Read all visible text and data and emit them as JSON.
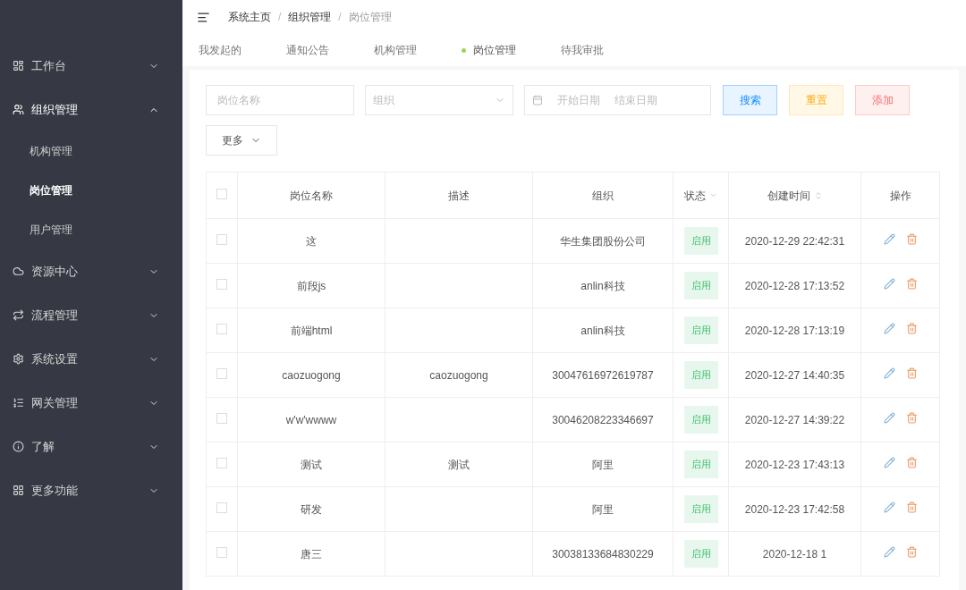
{
  "sidebar": {
    "items": [
      {
        "label": "工作台",
        "expanded": false
      },
      {
        "label": "组织管理",
        "expanded": true,
        "children": [
          {
            "label": "机构管理",
            "selected": false
          },
          {
            "label": "岗位管理",
            "selected": true
          },
          {
            "label": "用户管理",
            "selected": false
          }
        ]
      },
      {
        "label": "资源中心",
        "expanded": false
      },
      {
        "label": "流程管理",
        "expanded": false
      },
      {
        "label": "系统设置",
        "expanded": false
      },
      {
        "label": "网关管理",
        "expanded": false
      },
      {
        "label": "了解",
        "expanded": false
      },
      {
        "label": "更多功能",
        "expanded": false
      }
    ]
  },
  "breadcrumb": {
    "separator": "/",
    "items": [
      "系统主页",
      "组织管理",
      "岗位管理"
    ]
  },
  "tabs": [
    {
      "label": "我发起的",
      "selected": false
    },
    {
      "label": "通知公告",
      "selected": false
    },
    {
      "label": "机构管理",
      "selected": false
    },
    {
      "label": "岗位管理",
      "selected": true
    },
    {
      "label": "待我审批",
      "selected": false
    }
  ],
  "filters": {
    "name_placeholder": "岗位名称",
    "org_placeholder": "组织",
    "start_placeholder": "开始日期",
    "end_placeholder": "结束日期",
    "more": "更多"
  },
  "buttons": [
    {
      "label": "搜索",
      "kind": "search"
    },
    {
      "label": "重置",
      "kind": "reset"
    },
    {
      "label": "添加",
      "kind": "add"
    }
  ],
  "table": {
    "all_checked": false,
    "columns": [
      "岗位名称",
      "描述",
      "组织",
      "状态",
      "创建时间",
      "操作"
    ],
    "rows": [
      {
        "checked": false,
        "name": "这",
        "desc": "",
        "org": "华生集团股份公司",
        "status": "启用",
        "created": "2020-12-29 22:42:31"
      },
      {
        "checked": false,
        "name": "前段js",
        "desc": "",
        "org": "anlin科技",
        "status": "启用",
        "created": "2020-12-28 17:13:52"
      },
      {
        "checked": false,
        "name": "前端html",
        "desc": "",
        "org": "anlin科技",
        "status": "启用",
        "created": "2020-12-28 17:13:19"
      },
      {
        "checked": false,
        "name": "caozuogong",
        "desc": "caozuogong",
        "org": "30047616972619787",
        "status": "启用",
        "created": "2020-12-27 14:40:35"
      },
      {
        "checked": false,
        "name": "w'w'wwww",
        "desc": "",
        "org": "30046208223346697",
        "status": "启用",
        "created": "2020-12-27 14:39:22"
      },
      {
        "checked": false,
        "name": "测试",
        "desc": "测试",
        "org": "阿里",
        "status": "启用",
        "created": "2020-12-23 17:43:13"
      },
      {
        "checked": false,
        "name": "研发",
        "desc": "",
        "org": "阿里",
        "status": "启用",
        "created": "2020-12-23 17:42:58"
      },
      {
        "checked": false,
        "name": "唐三",
        "desc": "",
        "org": "30038133684830229",
        "status": "启用",
        "created": "2020-12-18 1"
      }
    ]
  }
}
